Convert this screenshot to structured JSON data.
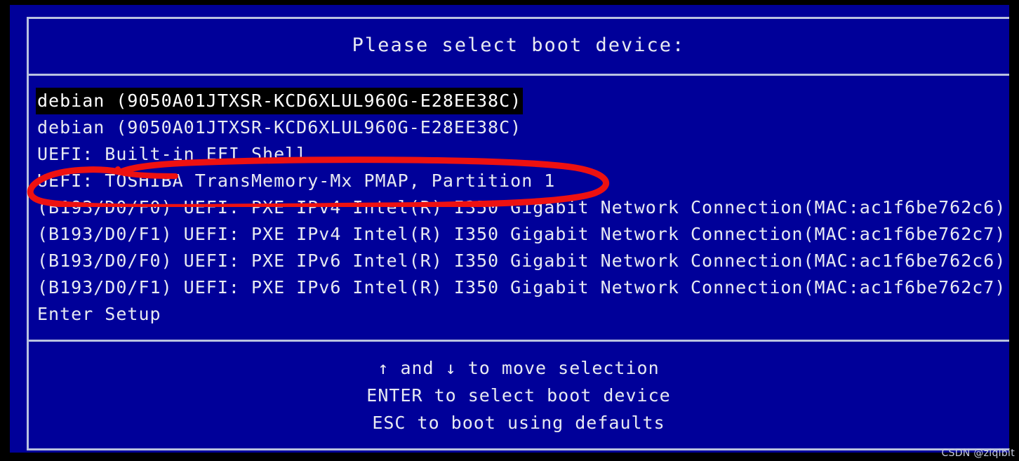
{
  "screen": {
    "title": "Please select boot device:",
    "background_color": "#000099",
    "text_color": "#e8eaf2",
    "frame_color": "#b9c2e0",
    "selection_background": "#000000",
    "annotation_color": "#ee1111"
  },
  "boot_list": {
    "selected_index": 0,
    "items": [
      {
        "label": "debian (9050A01JTXSR-KCD6XLUL960G-E28EE38C)",
        "selected": true
      },
      {
        "label": "debian (9050A01JTXSR-KCD6XLUL960G-E28EE38C)",
        "selected": false
      },
      {
        "label": "UEFI: Built-in EFI Shell",
        "selected": false
      },
      {
        "label": "UEFI: TOSHIBA TransMemory-Mx PMAP, Partition 1",
        "selected": false
      },
      {
        "label": "(B193/D0/F0) UEFI: PXE IPv4 Intel(R) I350 Gigabit Network Connection(MAC:ac1f6be762c6)",
        "selected": false
      },
      {
        "label": "(B193/D0/F1) UEFI: PXE IPv4 Intel(R) I350 Gigabit Network Connection(MAC:ac1f6be762c7)",
        "selected": false
      },
      {
        "label": "(B193/D0/F0) UEFI: PXE IPv6 Intel(R) I350 Gigabit Network Connection(MAC:ac1f6be762c6)",
        "selected": false
      },
      {
        "label": "(B193/D0/F1) UEFI: PXE IPv6 Intel(R) I350 Gigabit Network Connection(MAC:ac1f6be762c7)",
        "selected": false
      },
      {
        "label": "Enter Setup",
        "selected": false
      }
    ]
  },
  "footer": {
    "lines": [
      "↑ and ↓ to move selection",
      "ENTER to select boot device",
      "ESC to boot using defaults"
    ]
  },
  "annotation": {
    "name": "red-circle-highlight",
    "targets_item_index": 3,
    "shape": "hand-drawn-ellipse"
  },
  "watermark": {
    "text": "CSDN @ziqibit"
  }
}
